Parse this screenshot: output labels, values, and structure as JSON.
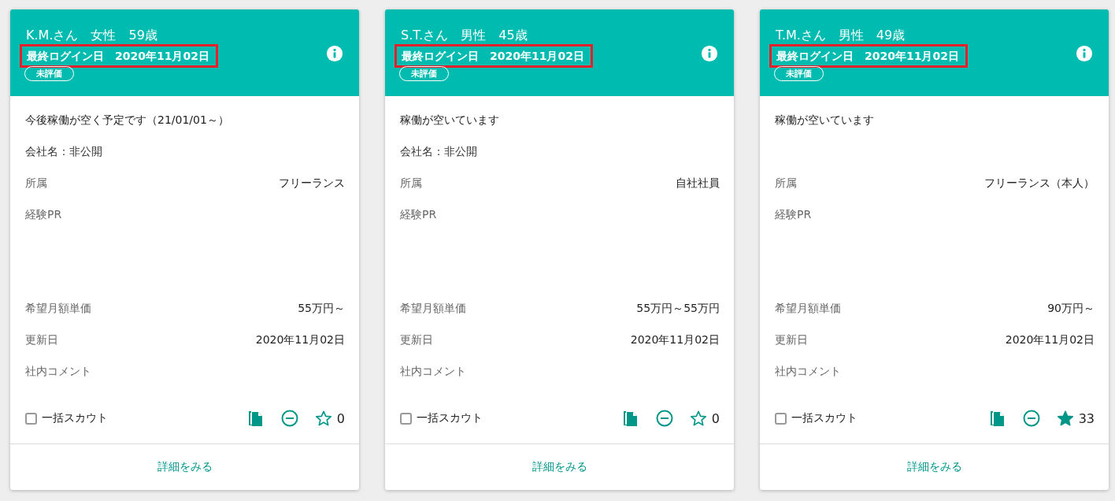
{
  "cards": [
    {
      "name": "K.M.さん　女性　59歳",
      "last_login": "最終ログイン日　2020年11月02日",
      "highlighted": true,
      "rating_badge": "未評価",
      "availability": "今後稼働が空く予定です（21/01/01～）",
      "company": "会社名：非公開",
      "fields": [
        {
          "label": "所属",
          "value": "フリーランス"
        },
        {
          "label": "経験PR"
        },
        {
          "label": "希望月額単価",
          "value": "55万円～"
        },
        {
          "label": "更新日",
          "value": "2020年11月02日"
        },
        {
          "label": "社内コメント"
        }
      ],
      "scout": {
        "label": "一括スカウト",
        "checked": false
      },
      "favorite": {
        "starred": false,
        "count": "0"
      },
      "detail_link": "詳細をみる"
    },
    {
      "name": "S.T.さん　男性　45歳",
      "last_login": "最終ログイン日　2020年11月02日",
      "highlighted": true,
      "rating_badge": "未評価",
      "availability": "稼働が空いています",
      "company": "会社名：非公開",
      "fields": [
        {
          "label": "所属",
          "value": "自社社員"
        },
        {
          "label": "経験PR"
        },
        {
          "label": "希望月額単価",
          "value": "55万円～55万円"
        },
        {
          "label": "更新日",
          "value": "2020年11月02日"
        },
        {
          "label": "社内コメント"
        }
      ],
      "scout": {
        "label": "一括スカウト",
        "checked": false
      },
      "favorite": {
        "starred": false,
        "count": "0"
      },
      "detail_link": "詳細をみる"
    },
    {
      "name": "T.M.さん　男性　49歳",
      "last_login": "最終ログイン日　2020年11月02日",
      "highlighted": true,
      "rating_badge": "未評価",
      "availability": "稼働が空いています",
      "fields": [
        {
          "label": "所属",
          "value": "フリーランス（本人）"
        },
        {
          "label": "経験PR"
        },
        {
          "label": "希望月額単価",
          "value": "90万円～"
        },
        {
          "label": "更新日",
          "value": "2020年11月02日"
        },
        {
          "label": "社内コメント"
        }
      ],
      "scout": {
        "label": "一括スカウト",
        "checked": false
      },
      "favorite": {
        "starred": true,
        "count": "33"
      },
      "detail_link": "詳細をみる"
    }
  ]
}
